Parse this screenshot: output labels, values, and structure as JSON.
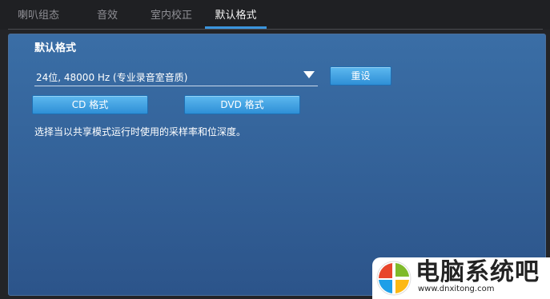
{
  "tabs": [
    {
      "label": "喇叭组态",
      "active": false
    },
    {
      "label": "音效",
      "active": false
    },
    {
      "label": "室内校正",
      "active": false
    },
    {
      "label": "默认格式",
      "active": true
    }
  ],
  "panel": {
    "title": "默认格式",
    "format_select": {
      "value": "24位, 48000 Hz (专业录音室音质)"
    },
    "reset_label": "重设",
    "cd_label": "CD 格式",
    "dvd_label": "DVD 格式",
    "description": "选择当以共享模式运行时使用的采样率和位深度。"
  },
  "watermark": {
    "text": "电脑系统吧",
    "url": "www.dnxitong.com"
  },
  "colors": {
    "accent": "#3a94dc",
    "panel_top": "#3a6ea6",
    "panel_bottom": "#2c548a",
    "button": "#2e8fd6"
  }
}
